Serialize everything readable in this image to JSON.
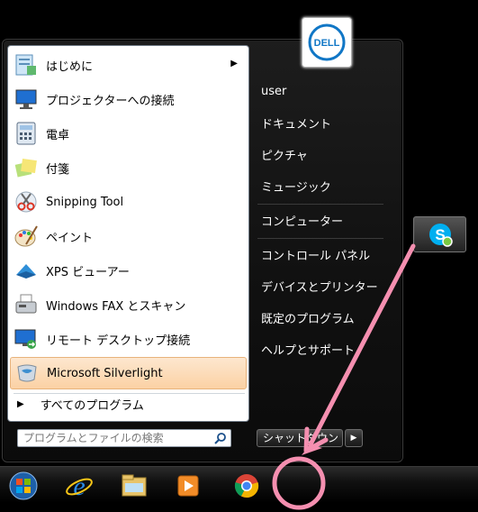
{
  "programs": [
    {
      "label": "はじめに",
      "icon": "getting-started-icon",
      "has_submenu": true
    },
    {
      "label": "プロジェクターへの接続",
      "icon": "projector-icon",
      "has_submenu": false
    },
    {
      "label": "電卓",
      "icon": "calculator-icon",
      "has_submenu": false
    },
    {
      "label": "付箋",
      "icon": "sticky-notes-icon",
      "has_submenu": false
    },
    {
      "label": "Snipping Tool",
      "icon": "scissors-icon",
      "has_submenu": false
    },
    {
      "label": "ペイント",
      "icon": "paint-palette-icon",
      "has_submenu": false
    },
    {
      "label": "XPS ビューアー",
      "icon": "xps-viewer-icon",
      "has_submenu": false
    },
    {
      "label": "Windows FAX とスキャン",
      "icon": "fax-scan-icon",
      "has_submenu": false
    },
    {
      "label": "リモート デスクトップ接続",
      "icon": "remote-desktop-icon",
      "has_submenu": false
    },
    {
      "label": "Microsoft Silverlight",
      "icon": "silverlight-icon",
      "has_submenu": false,
      "selected": true
    }
  ],
  "all_programs_label": "すべてのプログラム",
  "search": {
    "placeholder": "プログラムとファイルの検索"
  },
  "right_pane": {
    "user": "user",
    "items": [
      "ドキュメント",
      "ピクチャ",
      "ミュージック",
      "コンピューター",
      "コントロール パネル",
      "デバイスとプリンター",
      "既定のプログラム",
      "ヘルプとサポート"
    ]
  },
  "user_picture": {
    "brand": "DELL"
  },
  "shutdown": {
    "label": "シャットダウン"
  },
  "taskbar": {
    "items": [
      "start-orb-icon",
      "internet-explorer-icon",
      "file-explorer-icon",
      "media-player-icon",
      "chrome-icon"
    ]
  },
  "colors": {
    "selected_bg": "#fbd1a4",
    "annotation": "#f58fb0",
    "skype": "#00aff0"
  }
}
